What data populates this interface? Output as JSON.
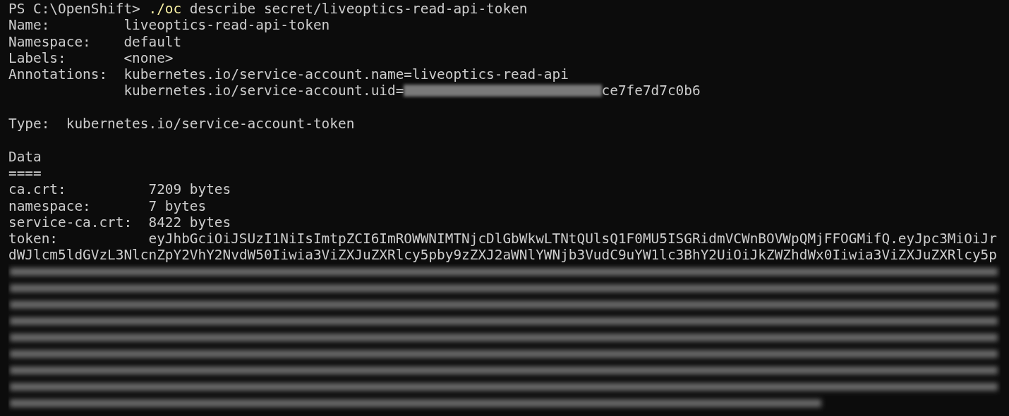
{
  "prompt": {
    "text": "PS C:\\OpenShift> ",
    "command": "./oc",
    "args": " describe secret/liveoptics-read-api-token"
  },
  "metadata": [
    {
      "label": "Name:",
      "values": [
        [
          {
            "kind": "text",
            "text": "liveoptics-read-api-token"
          }
        ]
      ]
    },
    {
      "label": "Namespace:",
      "values": [
        [
          {
            "kind": "text",
            "text": "default"
          }
        ]
      ]
    },
    {
      "label": "Labels:",
      "values": [
        [
          {
            "kind": "text",
            "text": "<none>"
          }
        ]
      ]
    },
    {
      "label": "Annotations:",
      "values": [
        [
          {
            "kind": "text",
            "text": "kubernetes.io/service-account.name=liveoptics-read-api"
          }
        ],
        [
          {
            "kind": "text",
            "text": "kubernetes.io/service-account.uid="
          },
          {
            "kind": "redacted"
          },
          {
            "kind": "text",
            "text": "ce7fe7d7c0b6"
          }
        ]
      ]
    }
  ],
  "type": {
    "label": "Type:",
    "value": "kubernetes.io/service-account-token"
  },
  "data": {
    "heading": "Data",
    "underline": "====",
    "entries": [
      {
        "label": "ca.crt:",
        "value": "7209 bytes"
      },
      {
        "label": "namespace:",
        "value": "7 bytes"
      },
      {
        "label": "service-ca.crt:",
        "value": "8422 bytes"
      }
    ]
  },
  "token": {
    "label": "token:",
    "first_line": "eyJhbGciOiJSUzI1NiIsImtpZCI6ImROWWNIMTNjcDlGbWkwLTNtQUlsQ1F0MU5ISGRidmVCWnBOVWpQMjFFOGMifQ.eyJpc3MiOiJr",
    "lines": [
      "dWJlcm5ldGVzL3NlcnZpY2VhY2NvdW50Iiwia3ViZXJuZXRlcy5pby9zZXJ2aWNlYWNjb3VudC9uYW1lc3BhY2UiOiJkZWZhdWx0Iiwia3ViZXJuZXRlcy5p"
    ],
    "redacted": true
  }
}
